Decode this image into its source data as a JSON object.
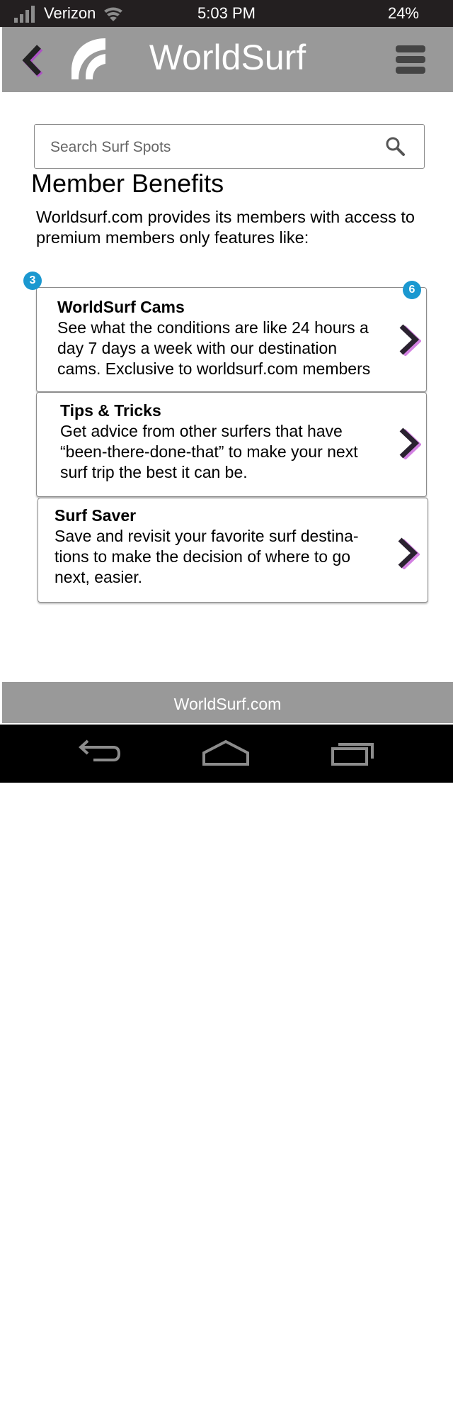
{
  "status_bar": {
    "carrier": "Verizon",
    "time": "5:03 PM",
    "battery": "24%",
    "icons": [
      "signal-bars-icon",
      "wifi-icon"
    ]
  },
  "header": {
    "title": "WorldSurf",
    "icons": [
      "back-chevron-icon",
      "worldsurf-logo",
      "hamburger-menu-icon"
    ]
  },
  "search": {
    "placeholder": "Search Surf Spots",
    "value": "",
    "icon": "search-icon"
  },
  "intro": {
    "title": "Member Benefits",
    "text_line1": "Worldsurf.com provides its members with access to",
    "text_line2": "premium members only features like:"
  },
  "badges": {
    "left": "3",
    "right": "6"
  },
  "benefits": [
    {
      "title": "WorldSurf Cams",
      "lines": [
        "See what the conditions are like 24 hours a",
        "day 7 days a week with our destination",
        "cams. Exclusive to worldsurf.com members"
      ]
    },
    {
      "title": "Tips & Tricks",
      "lines": [
        "Get advice from other surfers that have",
        "“been-there-done-that” to make your next",
        "surf trip the best it can be."
      ]
    },
    {
      "title": "Surf Saver",
      "lines": [
        "Save and revisit your favorite surf destina-",
        "tions to make the decision of where to go",
        "next, easier."
      ]
    }
  ],
  "footer": {
    "text": "WorldSurf.com"
  },
  "nav_bar": {
    "icons": [
      "back-arrow-icon",
      "home-icon",
      "recent-apps-icon"
    ]
  },
  "colors": {
    "header_bg": "#999999",
    "status_bg": "#231f20",
    "badge": "#1b98d0",
    "chevron_glow": "#c04bd6",
    "nav_bg": "#000000"
  }
}
